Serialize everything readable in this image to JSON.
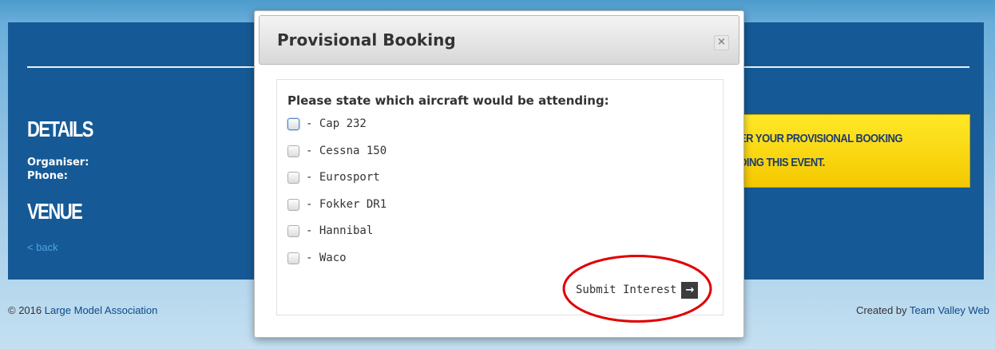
{
  "page": {
    "details_heading": "DETAILS",
    "organiser_label": "Organiser:",
    "phone_label": "Phone:",
    "venue_heading": "VENUE",
    "back_link": "< back",
    "notice_line1": "ER YOUR PROVISIONAL BOOKING",
    "notice_line2": "DING THIS EVENT."
  },
  "footer": {
    "copyright_prefix": "© 2016",
    "copyright_link": "Large Model Association",
    "credit_prefix": "Created by",
    "credit_link": "Team Valley Web"
  },
  "modal": {
    "title": "Provisional Booking",
    "close_label": "×",
    "prompt": "Please state which aircraft would be attending:",
    "aircraft": [
      {
        "label": "- Cap 232"
      },
      {
        "label": "- Cessna 150"
      },
      {
        "label": "- Eurosport"
      },
      {
        "label": "- Fokker DR1"
      },
      {
        "label": "- Hannibal"
      },
      {
        "label": "- Waco"
      }
    ],
    "submit_label": "Submit Interest",
    "submit_arrow": "→"
  },
  "colors": {
    "panel": "#155a96",
    "notice": "#f8d81a",
    "highlight": "#e00000"
  }
}
